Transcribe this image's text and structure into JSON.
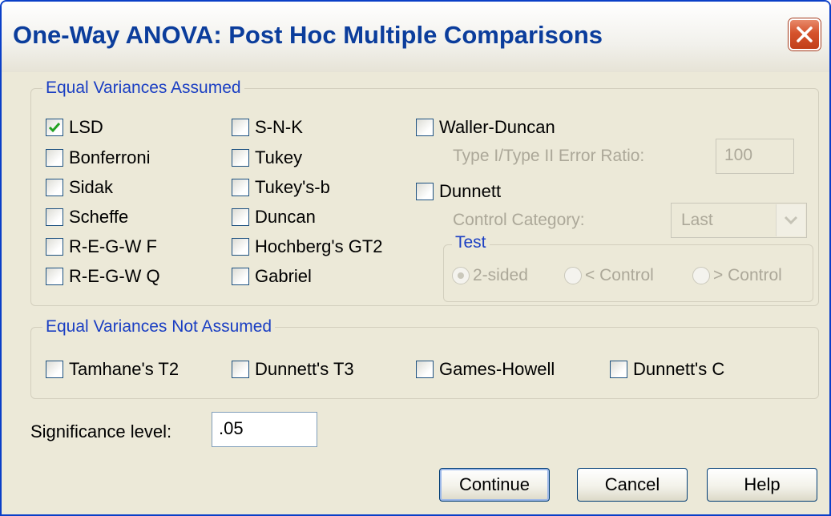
{
  "window": {
    "title": "One-Way ANOVA: Post Hoc Multiple Comparisons"
  },
  "equal_assumed": {
    "legend": "Equal Variances Assumed",
    "col1": [
      {
        "label": "LSD",
        "checked": true
      },
      {
        "label": "Bonferroni",
        "checked": false
      },
      {
        "label": "Sidak",
        "checked": false
      },
      {
        "label": "Scheffe",
        "checked": false
      },
      {
        "label": "R-E-G-W F",
        "checked": false
      },
      {
        "label": "R-E-G-W Q",
        "checked": false
      }
    ],
    "col2": [
      {
        "label": "S-N-K",
        "checked": false
      },
      {
        "label": "Tukey",
        "checked": false
      },
      {
        "label": "Tukey's-b",
        "checked": false
      },
      {
        "label": "Duncan",
        "checked": false
      },
      {
        "label": "Hochberg's GT2",
        "checked": false
      },
      {
        "label": "Gabriel",
        "checked": false
      }
    ],
    "waller": {
      "label": "Waller-Duncan",
      "ratio_label": "Type I/Type II Error Ratio:",
      "ratio_value": "100"
    },
    "dunnett": {
      "label": "Dunnett",
      "control_label": "Control Category:",
      "control_value": "Last",
      "test_legend": "Test",
      "options": [
        "2-sided",
        "< Control",
        "> Control"
      ],
      "selected": "2-sided"
    }
  },
  "equal_not_assumed": {
    "legend": "Equal Variances Not Assumed",
    "items": [
      "Tamhane's T2",
      "Dunnett's T3",
      "Games-Howell",
      "Dunnett's C"
    ]
  },
  "significance": {
    "label": "Significance level:",
    "value": ".05"
  },
  "buttons": {
    "continue": "Continue",
    "cancel": "Cancel",
    "help": "Help"
  }
}
